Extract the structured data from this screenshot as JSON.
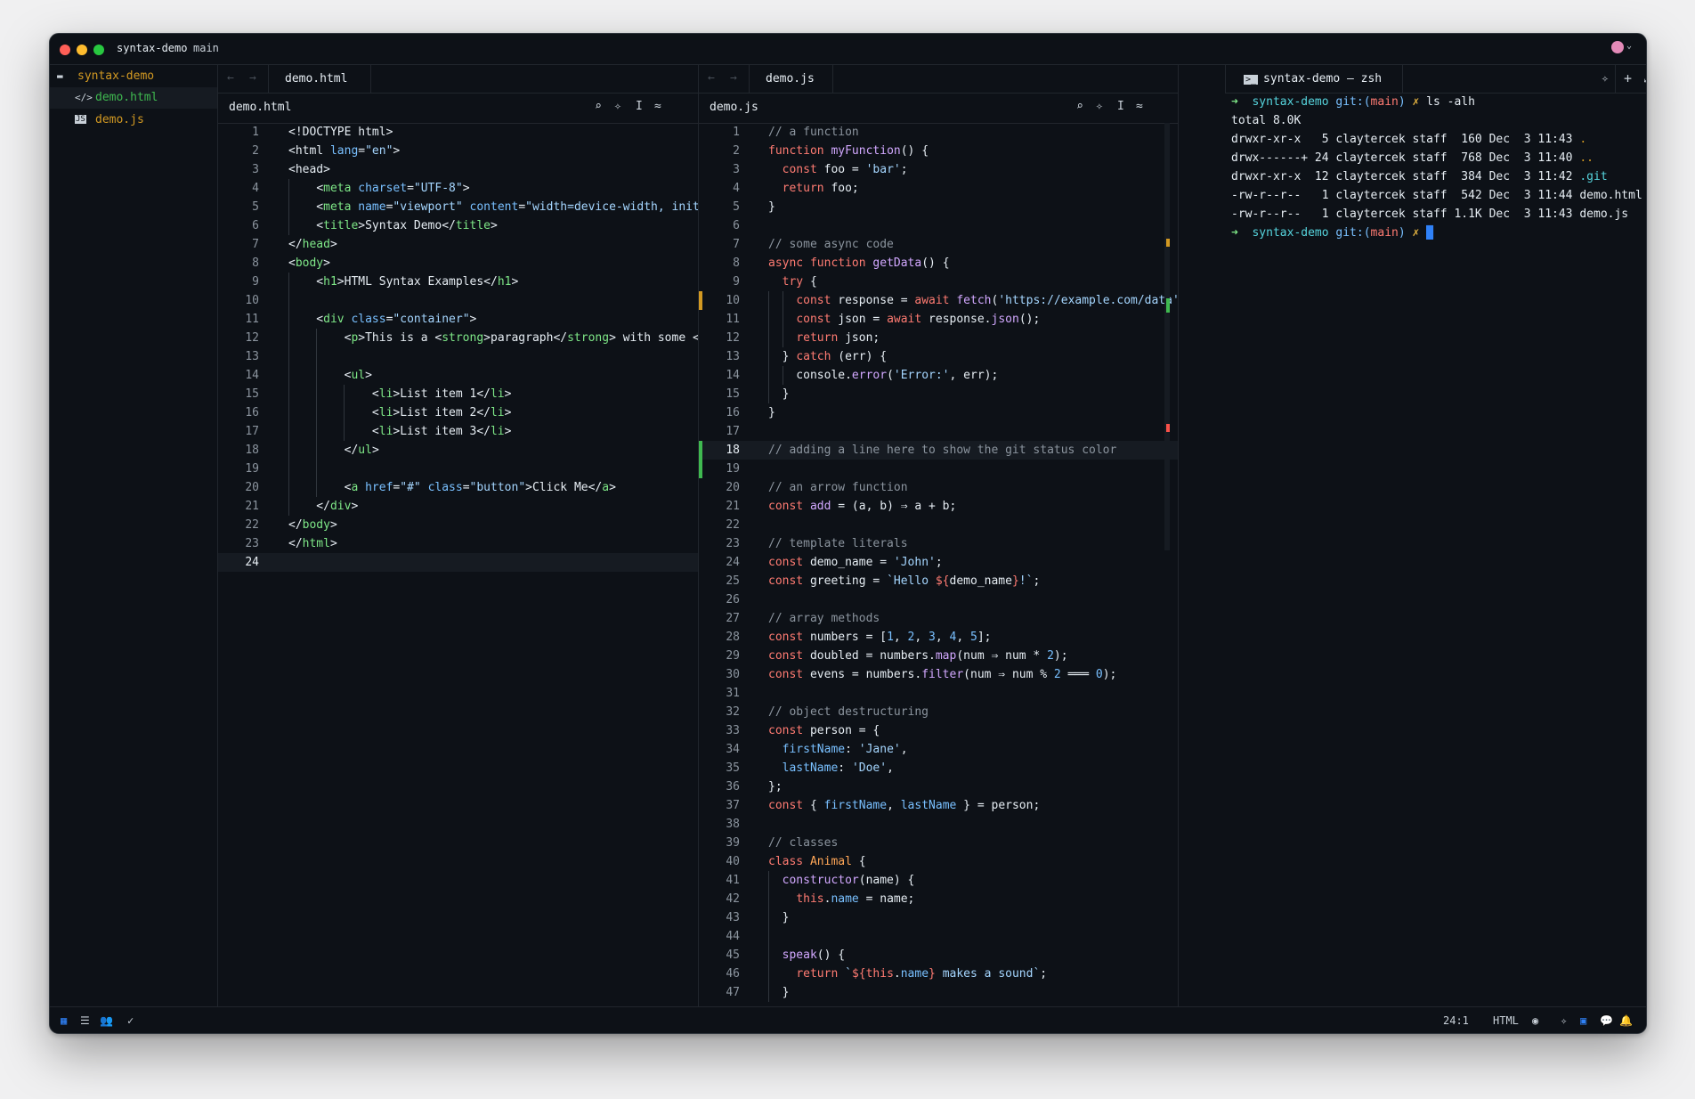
{
  "window": {
    "title": "syntax-demo",
    "branch": "main"
  },
  "sidebar": {
    "folder": "syntax-demo",
    "files": [
      {
        "name": "demo.html",
        "icon": "html-file-icon",
        "selected": true
      },
      {
        "name": "demo.js",
        "icon": "js-file-icon",
        "selected": false
      }
    ]
  },
  "html_pane": {
    "tab": "demo.html",
    "header": "demo.html",
    "lines": [
      {
        "n": "1",
        "html": "<span class='p'>&lt;!DOCTYPE html&gt;</span>"
      },
      {
        "n": "2",
        "html": "<span class='p'>&lt;html </span><span class='a'>lang</span><span class='p'>=</span><span class='s'>\"en\"</span><span class='p'>&gt;</span>"
      },
      {
        "n": "3",
        "html": "<span class='p'>&lt;head&gt;</span>"
      },
      {
        "n": "4",
        "html": "    <span class='p'>&lt;</span><span class='t'>meta</span> <span class='a'>charset</span>=<span class='s'>\"UTF-8\"</span>&gt;"
      },
      {
        "n": "5",
        "html": "    &lt;<span class='t'>meta</span> <span class='a'>name</span>=<span class='s'>\"viewport\"</span> <span class='a'>content</span>=<span class='s'>\"width=device-width, init</span>"
      },
      {
        "n": "6",
        "html": "    &lt;<span class='t'>title</span>&gt;Syntax Demo&lt;/<span class='t'>title</span>&gt;"
      },
      {
        "n": "7",
        "html": "&lt;/<span class='t'>head</span>&gt;"
      },
      {
        "n": "8",
        "html": "&lt;<span class='t'>body</span>&gt;"
      },
      {
        "n": "9",
        "html": "    &lt;<span class='t'>h1</span>&gt;HTML Syntax Examples&lt;/<span class='t'>h1</span>&gt;"
      },
      {
        "n": "10",
        "html": ""
      },
      {
        "n": "11",
        "html": "    &lt;<span class='t'>div</span> <span class='a'>class</span>=<span class='s'>\"container\"</span>&gt;"
      },
      {
        "n": "12",
        "html": "        &lt;<span class='t'>p</span>&gt;This is a &lt;<span class='t'>strong</span>&gt;paragraph&lt;/<span class='t'>strong</span>&gt; with some &lt;"
      },
      {
        "n": "13",
        "html": ""
      },
      {
        "n": "14",
        "html": "        &lt;<span class='t'>ul</span>&gt;"
      },
      {
        "n": "15",
        "html": "            &lt;<span class='t'>li</span>&gt;List item 1&lt;/<span class='t'>li</span>&gt;"
      },
      {
        "n": "16",
        "html": "            &lt;<span class='t'>li</span>&gt;List item 2&lt;/<span class='t'>li</span>&gt;"
      },
      {
        "n": "17",
        "html": "            &lt;<span class='t'>li</span>&gt;List item 3&lt;/<span class='t'>li</span>&gt;"
      },
      {
        "n": "18",
        "html": "        &lt;/<span class='t'>ul</span>&gt;"
      },
      {
        "n": "19",
        "html": ""
      },
      {
        "n": "20",
        "html": "        &lt;<span class='t'>a</span> <span class='a'>href</span>=<span class='s'>\"#\"</span> <span class='a'>class</span>=<span class='s'>\"button\"</span>&gt;Click Me&lt;/<span class='t'>a</span>&gt;"
      },
      {
        "n": "21",
        "html": "    &lt;/<span class='t'>div</span>&gt;"
      },
      {
        "n": "22",
        "html": "&lt;/<span class='t'>body</span>&gt;"
      },
      {
        "n": "23",
        "html": "&lt;/<span class='t'>html</span>&gt;"
      },
      {
        "n": "24",
        "html": ""
      }
    ]
  },
  "js_pane": {
    "tab": "demo.js",
    "header": "demo.js",
    "lines": [
      {
        "n": "1",
        "html": "<span class='c'>// a function</span>"
      },
      {
        "n": "2",
        "html": "<span class='k'>function</span> <span class='f'>myFunction</span>() {"
      },
      {
        "n": "3",
        "html": "  <span class='k'>const</span> foo = <span class='s'>'bar'</span>;"
      },
      {
        "n": "4",
        "html": "  <span class='k'>return</span> foo;"
      },
      {
        "n": "5",
        "html": "}"
      },
      {
        "n": "6",
        "html": ""
      },
      {
        "n": "7",
        "html": "<span class='c'>// some async code</span>"
      },
      {
        "n": "8",
        "html": "<span class='k'>async</span> <span class='k'>function</span> <span class='f'>getData</span>() {"
      },
      {
        "n": "9",
        "html": "  <span class='k'>try</span> {"
      },
      {
        "n": "10",
        "html": "    <span class='k'>const</span> response = <span class='k'>await</span> <span class='f'>fetch</span>(<span class='s'>'https://example.com/data'</span>"
      },
      {
        "n": "11",
        "html": "    <span class='k'>const</span> json = <span class='k'>await</span> response.<span class='f'>json</span>();"
      },
      {
        "n": "12",
        "html": "    <span class='k'>return</span> json;"
      },
      {
        "n": "13",
        "html": "  } <span class='k'>catch</span> (err) {"
      },
      {
        "n": "14",
        "html": "    console.<span class='f'>error</span>(<span class='s'>'Error:'</span>, err);"
      },
      {
        "n": "15",
        "html": "  }"
      },
      {
        "n": "16",
        "html": "}"
      },
      {
        "n": "17",
        "html": ""
      },
      {
        "n": "18",
        "html": "<span class='c'>// adding a line here to show the git status color</span>"
      },
      {
        "n": "19",
        "html": ""
      },
      {
        "n": "20",
        "html": "<span class='c'>// an arrow function</span>"
      },
      {
        "n": "21",
        "html": "<span class='k'>const</span> <span class='f'>add</span> = (a, b) ⇒ a + b;"
      },
      {
        "n": "22",
        "html": ""
      },
      {
        "n": "23",
        "html": "<span class='c'>// template literals</span>"
      },
      {
        "n": "24",
        "html": "<span class='k'>const</span> demo_name = <span class='s'>'John'</span>;"
      },
      {
        "n": "25",
        "html": "<span class='k'>const</span> greeting = <span class='s'>`Hello </span><span class='k'>${</span>demo_name<span class='k'>}</span><span class='s'>!`</span>;"
      },
      {
        "n": "26",
        "html": ""
      },
      {
        "n": "27",
        "html": "<span class='c'>// array methods</span>"
      },
      {
        "n": "28",
        "html": "<span class='k'>const</span> numbers = [<span class='n'>1</span>, <span class='n'>2</span>, <span class='n'>3</span>, <span class='n'>4</span>, <span class='n'>5</span>];"
      },
      {
        "n": "29",
        "html": "<span class='k'>const</span> doubled = numbers.<span class='f'>map</span>(num ⇒ num * <span class='n'>2</span>);"
      },
      {
        "n": "30",
        "html": "<span class='k'>const</span> evens = numbers.<span class='f'>filter</span>(num ⇒ num % <span class='n'>2</span> ═══ <span class='n'>0</span>);"
      },
      {
        "n": "31",
        "html": ""
      },
      {
        "n": "32",
        "html": "<span class='c'>// object destructuring</span>"
      },
      {
        "n": "33",
        "html": "<span class='k'>const</span> person = {"
      },
      {
        "n": "34",
        "html": "  <span class='n'>firstName</span>: <span class='s'>'Jane'</span>,"
      },
      {
        "n": "35",
        "html": "  <span class='n'>lastName</span>: <span class='s'>'Doe'</span>,"
      },
      {
        "n": "36",
        "html": "};"
      },
      {
        "n": "37",
        "html": "<span class='k'>const</span> { <span class='n'>firstName</span>, <span class='n'>lastName</span> } = person;"
      },
      {
        "n": "38",
        "html": ""
      },
      {
        "n": "39",
        "html": "<span class='c'>// classes</span>"
      },
      {
        "n": "40",
        "html": "<span class='k'>class</span> <span class='v'>Animal</span> {"
      },
      {
        "n": "41",
        "html": "  <span class='f'>constructor</span>(name) {"
      },
      {
        "n": "42",
        "html": "    <span class='k'>this</span>.<span class='n'>name</span> = name;"
      },
      {
        "n": "43",
        "html": "  }"
      },
      {
        "n": "44",
        "html": ""
      },
      {
        "n": "45",
        "html": "  <span class='f'>speak</span>() {"
      },
      {
        "n": "46",
        "html": "    <span class='k'>return</span> <span class='s'>`</span><span class='k'>${this</span>.<span class='n'>name</span><span class='k'>}</span><span class='s'> makes a sound`</span>;"
      },
      {
        "n": "47",
        "html": "  }"
      }
    ]
  },
  "terminal": {
    "tab": "syntax-demo — zsh",
    "lines": [
      {
        "html": "<span class='t'>➜</span>  <span style='color:#56d4dd'>syntax-demo</span> <span class='a'>git:(</span><span class='k'>main</span><span class='a'>)</span> <span style='color:#e3b341'>✗</span> ls -alh"
      },
      {
        "html": "total 8.0K"
      },
      {
        "html": "drwxr-xr-x   5 claytercek staff  160 Dec  3 11:43 <span style='color:#d29922'>.</span>"
      },
      {
        "html": "drwx------+ 24 claytercek staff  768 Dec  3 11:40 <span style='color:#d29922'>..</span>"
      },
      {
        "html": "drwxr-xr-x  12 claytercek staff  384 Dec  3 11:42 <span style='color:#56d4dd'>.git</span>"
      },
      {
        "html": "-rw-r--r--   1 claytercek staff  542 Dec  3 11:44 demo.html"
      },
      {
        "html": "-rw-r--r--   1 claytercek staff 1.1K Dec  3 11:43 demo.js"
      },
      {
        "html": "<span class='t'>➜</span>  <span style='color:#56d4dd'>syntax-demo</span> <span class='a'>git:(</span><span class='k'>main</span><span class='a'>)</span> <span style='color:#e3b341'>✗</span> <span style='background:#2f81f7;color:#2f81f7'>█</span>"
      }
    ]
  },
  "status": {
    "cursor": "24:1",
    "language": "HTML"
  },
  "colors": {
    "background": "#0d1117",
    "accent": "#2f81f7",
    "git_added": "#3fb950",
    "git_modified": "#d29922",
    "git_deleted": "#f85149"
  }
}
